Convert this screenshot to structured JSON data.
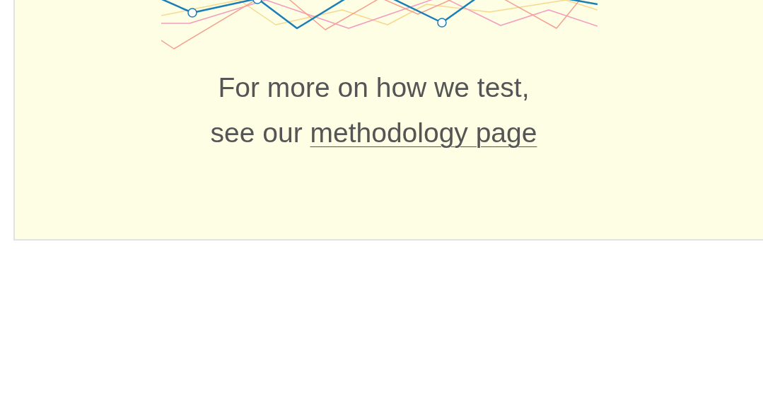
{
  "note": {
    "first_line": "For more on how we test,",
    "second_line_lead": "see our",
    "link": "methodology page"
  }
}
